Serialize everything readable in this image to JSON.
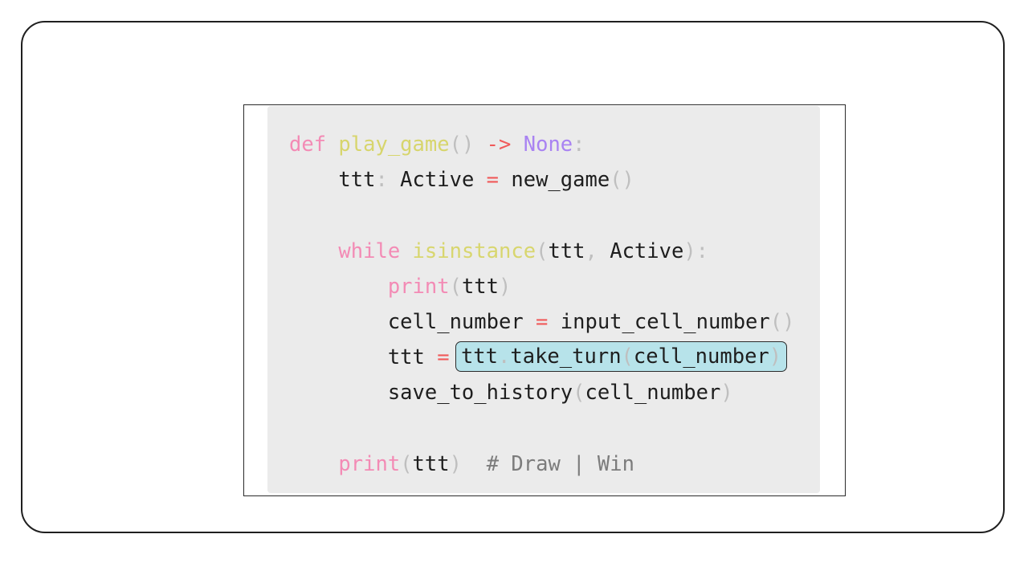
{
  "colors": {
    "background": "#ffffff",
    "frame_border": "#1f1f1f",
    "code_panel": "#ebebeb",
    "highlight_fill": "#b7e3ea",
    "keyword": "#f38bb5",
    "function_name": "#d7d56c",
    "operator": "#f05a5a",
    "constant": "#a983f2",
    "punctuation": "#bfbfbf",
    "comment": "#7c7c7c",
    "default_text": "#1e1e1e"
  },
  "code": {
    "language": "python",
    "highlighted_expression": "ttt.take_turn(cell_number)",
    "lines": [
      [
        {
          "text": "def",
          "kind": "keyword"
        },
        {
          "text": " ",
          "kind": "default"
        },
        {
          "text": "play_game",
          "kind": "func-def"
        },
        {
          "text": "()",
          "kind": "punct"
        },
        {
          "text": " ",
          "kind": "default"
        },
        {
          "text": "->",
          "kind": "op"
        },
        {
          "text": " ",
          "kind": "default"
        },
        {
          "text": "None",
          "kind": "const"
        },
        {
          "text": ":",
          "kind": "punct"
        }
      ],
      [
        {
          "text": "    ttt",
          "kind": "default"
        },
        {
          "text": ":",
          "kind": "punct"
        },
        {
          "text": " Active ",
          "kind": "default"
        },
        {
          "text": "=",
          "kind": "op"
        },
        {
          "text": " new_game",
          "kind": "default"
        },
        {
          "text": "()",
          "kind": "punct"
        }
      ],
      [],
      [
        {
          "text": "    ",
          "kind": "default"
        },
        {
          "text": "while",
          "kind": "keyword"
        },
        {
          "text": " ",
          "kind": "default"
        },
        {
          "text": "isinstance",
          "kind": "builtin-yellow"
        },
        {
          "text": "(",
          "kind": "punct"
        },
        {
          "text": "ttt",
          "kind": "default"
        },
        {
          "text": ",",
          "kind": "punct"
        },
        {
          "text": " Active",
          "kind": "default"
        },
        {
          "text": "):",
          "kind": "punct"
        }
      ],
      [
        {
          "text": "        ",
          "kind": "default"
        },
        {
          "text": "print",
          "kind": "builtin-call"
        },
        {
          "text": "(",
          "kind": "punct"
        },
        {
          "text": "ttt",
          "kind": "default"
        },
        {
          "text": ")",
          "kind": "punct"
        }
      ],
      [
        {
          "text": "        cell_number ",
          "kind": "default"
        },
        {
          "text": "=",
          "kind": "op"
        },
        {
          "text": " input_cell_number",
          "kind": "default"
        },
        {
          "text": "()",
          "kind": "punct"
        }
      ],
      [
        {
          "text": "        ttt ",
          "kind": "default"
        },
        {
          "text": "=",
          "kind": "op"
        },
        {
          "text": " ",
          "kind": "default"
        },
        {
          "highlight": true,
          "tokens": [
            {
              "text": "ttt",
              "kind": "default"
            },
            {
              "text": ".",
              "kind": "punct"
            },
            {
              "text": "take_turn",
              "kind": "default"
            },
            {
              "text": "(",
              "kind": "punct"
            },
            {
              "text": "cell_number",
              "kind": "default"
            },
            {
              "text": ")",
              "kind": "punct"
            }
          ]
        }
      ],
      [
        {
          "text": "        save_to_history",
          "kind": "default"
        },
        {
          "text": "(",
          "kind": "punct"
        },
        {
          "text": "cell_number",
          "kind": "default"
        },
        {
          "text": ")",
          "kind": "punct"
        }
      ],
      [],
      [
        {
          "text": "    ",
          "kind": "default"
        },
        {
          "text": "print",
          "kind": "builtin-call"
        },
        {
          "text": "(",
          "kind": "punct"
        },
        {
          "text": "ttt",
          "kind": "default"
        },
        {
          "text": ")",
          "kind": "punct"
        },
        {
          "text": "  ",
          "kind": "default"
        },
        {
          "text": "# Draw | Win",
          "kind": "comment"
        }
      ]
    ]
  }
}
